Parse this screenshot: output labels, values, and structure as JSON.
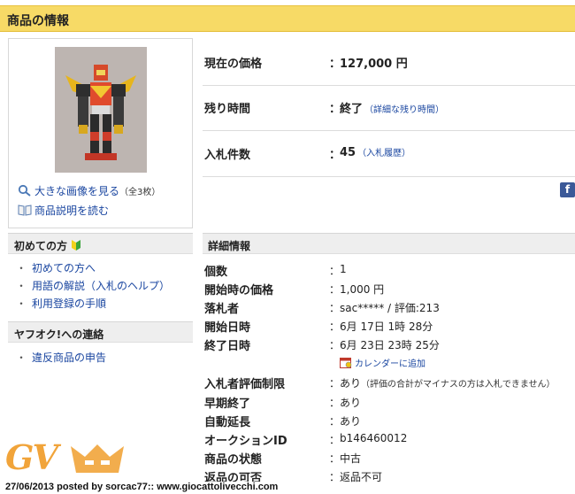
{
  "header": {
    "title": "商品の情報"
  },
  "image_panel": {
    "large_image_link": "大きな画像を見る",
    "large_image_count": "（全3枚）",
    "description_link": "商品説明を読む"
  },
  "sidebar": {
    "first_time": {
      "title": "初めての方",
      "links": [
        "初めての方へ",
        "用語の解説（入札のヘルプ）",
        "利用登録の手順"
      ]
    },
    "contact": {
      "title": "ヤフオク!への連絡",
      "links": [
        "違反商品の申告"
      ]
    }
  },
  "summary": {
    "price_label": "現在の価格",
    "price_value": "127,000 円",
    "time_label": "残り時間",
    "time_value": "終了",
    "time_link": "（詳細な残り時間）",
    "bids_label": "入札件数",
    "bids_value": "45",
    "bids_link": "（入札履歴）",
    "colon": "："
  },
  "share": {
    "facebook": "f"
  },
  "details": {
    "title": "詳細情報",
    "rows": [
      {
        "label": "個数",
        "value": "1"
      },
      {
        "label": "開始時の価格",
        "value": "1,000 円"
      },
      {
        "label": "落札者",
        "value": "sac***** / 評価:213"
      },
      {
        "label": "開始日時",
        "value": "6月 17日 1時 28分"
      },
      {
        "label": "終了日時",
        "value": "6月 23日 23時 25分"
      },
      {
        "label": "入札者評価制限",
        "value": "あり",
        "note": "（評価の合計がマイナスの方は入札できません）"
      },
      {
        "label": "早期終了",
        "value": "あり"
      },
      {
        "label": "自動延長",
        "value": "あり"
      },
      {
        "label": "オークションID",
        "value": "b146460012"
      },
      {
        "label": "商品の状態",
        "value": "中古"
      },
      {
        "label": "返品の可否",
        "value": "返品不可"
      }
    ],
    "calendar_link": "カレンダーに追加"
  },
  "watermark": {
    "logo": "GV",
    "caption": "27/06/2013 posted by sorcac77:: www.giocattolivecchi.com"
  },
  "colors": {
    "header_bg": "#f7da66",
    "link": "#1a46a0",
    "section_bg": "#eeeeee",
    "watermark": "#f1a43a"
  }
}
